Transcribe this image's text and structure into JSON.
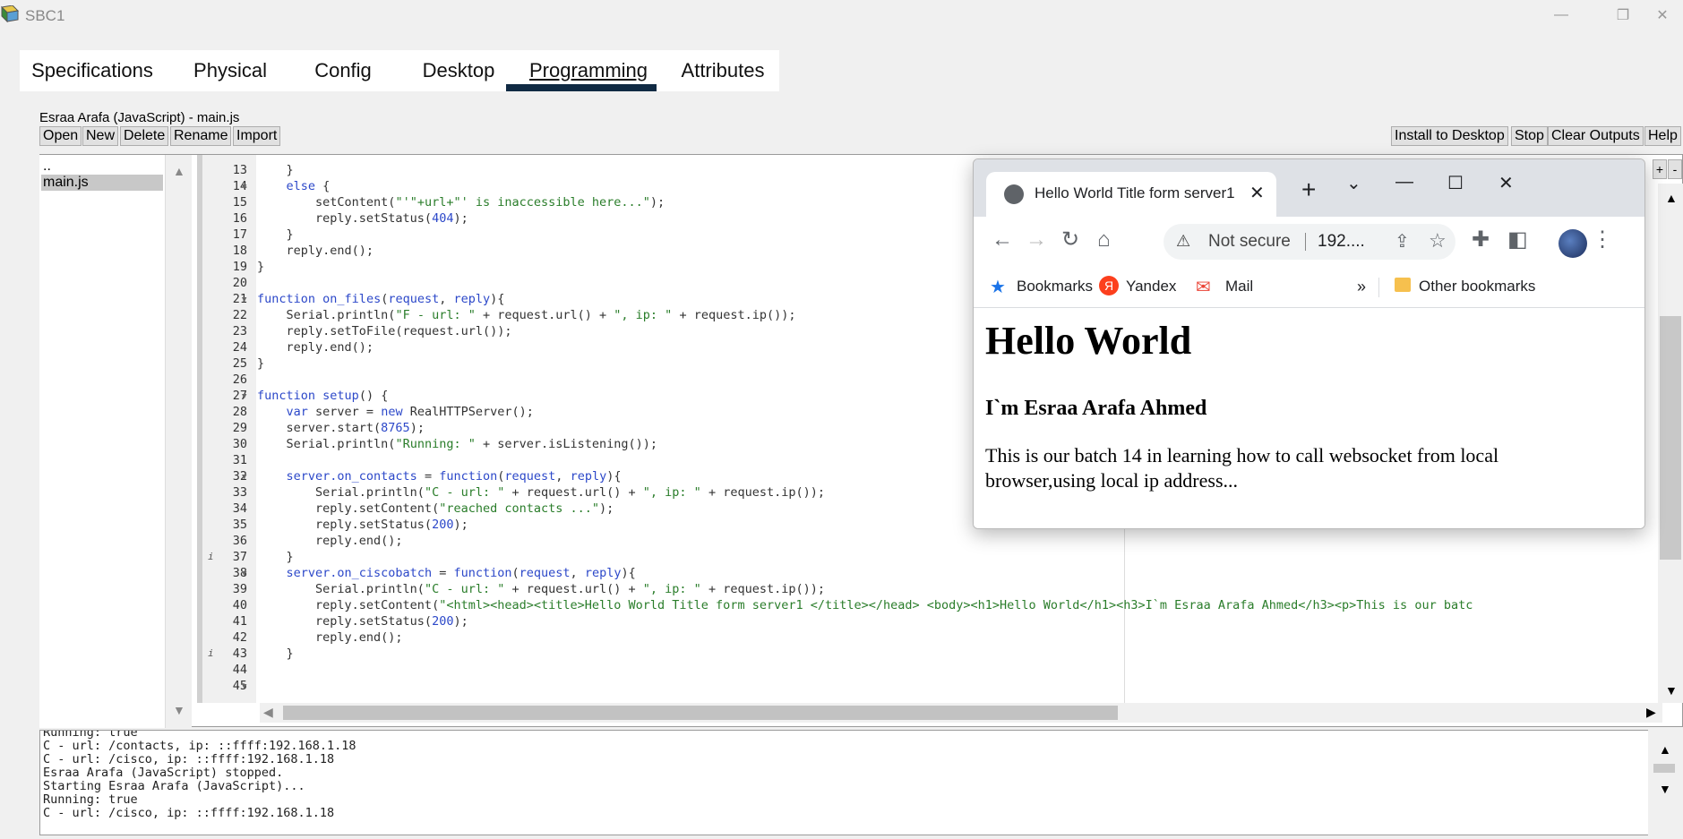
{
  "window": {
    "title": "SBC1",
    "controls": [
      "—",
      "❐",
      "✕"
    ]
  },
  "tabs": [
    {
      "label": "Specifications"
    },
    {
      "label": "Physical"
    },
    {
      "label": "Config"
    },
    {
      "label": "Desktop"
    },
    {
      "label": "Programming",
      "active": true
    },
    {
      "label": "Attributes"
    }
  ],
  "project": {
    "label": "Esraa Arafa (JavaScript) - main.js"
  },
  "toolbar": {
    "open": "Open",
    "new": "New",
    "delete": "Delete",
    "rename": "Rename",
    "import": "Import",
    "install": "Install to Desktop",
    "stop": "Stop",
    "clear": "Clear Outputs",
    "help": "Help"
  },
  "files": {
    "parent": "..",
    "items": [
      "main.js"
    ]
  },
  "editor": {
    "lines": [
      {
        "n": "13",
        "fold": false,
        "info": false,
        "html": "    }"
      },
      {
        "n": "14",
        "fold": true,
        "info": false,
        "html": "    <span class='kw'>else</span> {"
      },
      {
        "n": "15",
        "fold": false,
        "info": false,
        "html": "        setContent(<span class='str'>\"'\"+url+\"' is inaccessible here...\"</span>);"
      },
      {
        "n": "16",
        "fold": false,
        "info": false,
        "html": "        reply.setStatus(<span class='num'>404</span>);"
      },
      {
        "n": "17",
        "fold": false,
        "info": false,
        "html": "    }"
      },
      {
        "n": "18",
        "fold": false,
        "info": false,
        "html": "    reply.end();"
      },
      {
        "n": "19",
        "fold": false,
        "info": false,
        "html": "}"
      },
      {
        "n": "20",
        "fold": false,
        "info": false,
        "html": ""
      },
      {
        "n": "21",
        "fold": true,
        "info": false,
        "html": "<span class='kw'>function</span> <span class='fn'>on_files</span>(<span class='kw'>request</span>, <span class='kw'>reply</span>){"
      },
      {
        "n": "22",
        "fold": false,
        "info": false,
        "html": "    Serial.println(<span class='str'>\"F - url: \"</span> + request.url() + <span class='str'>\", ip: \"</span> + request.ip());"
      },
      {
        "n": "23",
        "fold": false,
        "info": false,
        "html": "    reply.setToFile(request.url());"
      },
      {
        "n": "24",
        "fold": false,
        "info": false,
        "html": "    reply.end();"
      },
      {
        "n": "25",
        "fold": false,
        "info": false,
        "html": "}"
      },
      {
        "n": "26",
        "fold": false,
        "info": false,
        "html": ""
      },
      {
        "n": "27",
        "fold": true,
        "info": false,
        "html": "<span class='kw'>function</span> <span class='fn'>setup</span>() {"
      },
      {
        "n": "28",
        "fold": false,
        "info": false,
        "html": "    <span class='kw'>var</span> server = <span class='kw'>new</span> RealHTTPServer();"
      },
      {
        "n": "29",
        "fold": false,
        "info": false,
        "html": "    server.start(<span class='num'>8765</span>);"
      },
      {
        "n": "30",
        "fold": false,
        "info": false,
        "html": "    Serial.println(<span class='str'>\"Running: \"</span> + server.isListening());"
      },
      {
        "n": "31",
        "fold": false,
        "info": false,
        "html": ""
      },
      {
        "n": "32",
        "fold": true,
        "info": false,
        "html": "    <span class='kw'>server.on_contacts</span> = <span class='kw'>function</span>(<span class='kw'>request</span>, <span class='kw'>reply</span>){"
      },
      {
        "n": "33",
        "fold": false,
        "info": false,
        "html": "        Serial.println(<span class='str'>\"C - url: \"</span> + request.url() + <span class='str'>\", ip: \"</span> + request.ip());"
      },
      {
        "n": "34",
        "fold": false,
        "info": false,
        "html": "        reply.setContent(<span class='str'>\"reached contacts ...\"</span>);"
      },
      {
        "n": "35",
        "fold": false,
        "info": false,
        "html": "        reply.setStatus(<span class='num'>200</span>);"
      },
      {
        "n": "36",
        "fold": false,
        "info": false,
        "html": "        reply.end();"
      },
      {
        "n": "37",
        "fold": false,
        "info": true,
        "html": "    }"
      },
      {
        "n": "38",
        "fold": true,
        "info": false,
        "html": "    <span class='kw'>server.on_ciscobatch</span> = <span class='kw'>function</span>(<span class='kw'>request</span>, <span class='kw'>reply</span>){"
      },
      {
        "n": "39",
        "fold": false,
        "info": false,
        "html": "        Serial.println(<span class='str'>\"C - url: \"</span> + request.url() + <span class='str'>\", ip: \"</span> + request.ip());"
      },
      {
        "n": "40",
        "fold": false,
        "info": false,
        "html": "        reply.setContent(<span class='str'>\"&lt;html&gt;&lt;head&gt;&lt;title&gt;Hello World Title form server1 &lt;/title&gt;&lt;/head&gt; &lt;body&gt;&lt;h1&gt;Hello World&lt;/h1&gt;&lt;h3&gt;I`m Esraa Arafa Ahmed&lt;/h3&gt;&lt;p&gt;This is our batc</span>"
      },
      {
        "n": "41",
        "fold": false,
        "info": false,
        "html": "        reply.setStatus(<span class='num'>200</span>);"
      },
      {
        "n": "42",
        "fold": false,
        "info": false,
        "html": "        reply.end();"
      },
      {
        "n": "43",
        "fold": false,
        "info": true,
        "html": "    }"
      },
      {
        "n": "44",
        "fold": false,
        "info": false,
        "html": ""
      },
      {
        "n": "45",
        "fold": true,
        "info": false,
        "html": ""
      }
    ]
  },
  "console": {
    "lines": [
      "Running: true",
      "C - url: /contacts, ip: ::ffff:192.168.1.18",
      "C - url: /cisco, ip: ::ffff:192.168.1.18",
      "Esraa Arafa (JavaScript) stopped.",
      "Starting Esraa Arafa (JavaScript)...",
      "Running: true",
      "C - url: /cisco, ip: ::ffff:192.168.1.18"
    ]
  },
  "browser": {
    "tab_title": "Hello World Title form server1",
    "security": "Not secure",
    "url": "192....",
    "bookmarks": [
      "Bookmarks",
      "Yandex",
      "Mail"
    ],
    "other_bookmarks": "Other bookmarks",
    "more": "»",
    "page": {
      "h1": "Hello World",
      "h3": "I`m Esraa Arafa Ahmed",
      "p": "This is our batch 14 in learning how to call websocket from local browser,using local ip address..."
    }
  },
  "colors": {
    "active_tab_bar": "#102a43",
    "keyword": "#2c48c9",
    "string": "#2a7d2a"
  }
}
